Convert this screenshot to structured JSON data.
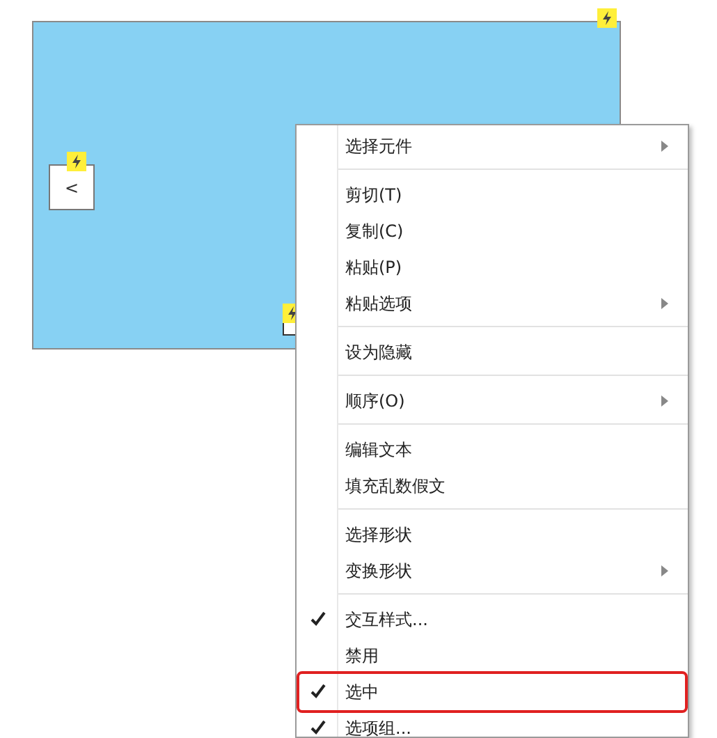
{
  "canvas": {
    "button": {
      "label": "<"
    },
    "checkbox": {
      "checked": false
    }
  },
  "context_menu": {
    "items": [
      {
        "kind": "item",
        "label": "选择元件",
        "checked": false,
        "submenu": true,
        "selected": false
      },
      {
        "kind": "separator"
      },
      {
        "kind": "item",
        "label": "剪切(T)",
        "checked": false,
        "submenu": false,
        "selected": false
      },
      {
        "kind": "item",
        "label": "复制(C)",
        "checked": false,
        "submenu": false,
        "selected": false
      },
      {
        "kind": "item",
        "label": "粘贴(P)",
        "checked": false,
        "submenu": false,
        "selected": false
      },
      {
        "kind": "item",
        "label": "粘贴选项",
        "checked": false,
        "submenu": true,
        "selected": false
      },
      {
        "kind": "separator"
      },
      {
        "kind": "item",
        "label": "设为隐藏",
        "checked": false,
        "submenu": false,
        "selected": false
      },
      {
        "kind": "separator"
      },
      {
        "kind": "item",
        "label": "顺序(O)",
        "checked": false,
        "submenu": true,
        "selected": false
      },
      {
        "kind": "separator"
      },
      {
        "kind": "item",
        "label": "编辑文本",
        "checked": false,
        "submenu": false,
        "selected": false
      },
      {
        "kind": "item",
        "label": "填充乱数假文",
        "checked": false,
        "submenu": false,
        "selected": false
      },
      {
        "kind": "separator"
      },
      {
        "kind": "item",
        "label": "选择形状",
        "checked": false,
        "submenu": false,
        "selected": false
      },
      {
        "kind": "item",
        "label": "变换形状",
        "checked": false,
        "submenu": true,
        "selected": false
      },
      {
        "kind": "separator"
      },
      {
        "kind": "item",
        "label": "交互样式...",
        "checked": true,
        "submenu": false,
        "selected": false
      },
      {
        "kind": "item",
        "label": "禁用",
        "checked": false,
        "submenu": false,
        "selected": false
      },
      {
        "kind": "item",
        "label": "选中",
        "checked": true,
        "submenu": false,
        "selected": true
      },
      {
        "kind": "item",
        "label": "选项组...",
        "checked": true,
        "submenu": false,
        "selected": false
      }
    ]
  }
}
